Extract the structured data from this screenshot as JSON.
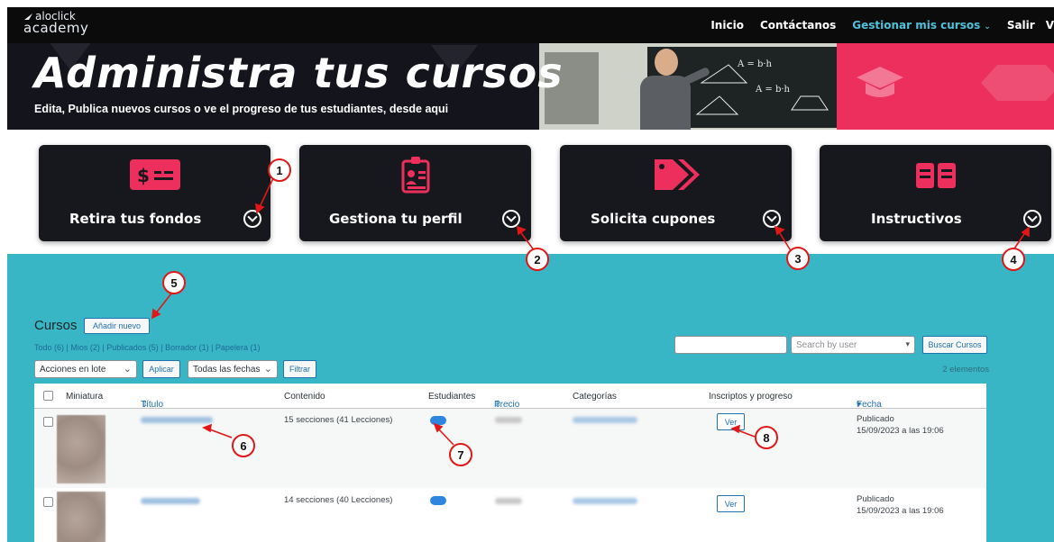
{
  "brand": {
    "line1": "aloclick",
    "line2": "academy"
  },
  "nav": {
    "home": "Inicio",
    "contact": "Contáctanos",
    "manage": "Gestionar mis cursos",
    "logout": "Salir",
    "extra": "V"
  },
  "hero": {
    "title": "Administra tus cursos",
    "subtitle": "Edita, Publica nuevos cursos o ve el progreso de tus estudiantes, desde aqui"
  },
  "cards": [
    {
      "icon": "money-icon",
      "label": "Retira tus fondos"
    },
    {
      "icon": "profile-id-icon",
      "label": "Gestiona tu perfil"
    },
    {
      "icon": "coupon-tag-icon",
      "label": "Solicita cupones"
    },
    {
      "icon": "book-icon",
      "label": "Instructivos"
    }
  ],
  "annotations": [
    "1",
    "2",
    "3",
    "4",
    "5",
    "6",
    "7",
    "8"
  ],
  "courses": {
    "title": "Cursos",
    "add_new": "Añadir nuevo",
    "filter_links": "Todo (6) | Mios (2) | Publicados (5) | Borrador (1) | Papelera (1)",
    "filter_current": "Mios (2)",
    "search_placeholder": "",
    "search_user_placeholder": "Search by user",
    "search_button": "Buscar Cursos",
    "bulk_actions": "Acciones en lote",
    "apply": "Aplicar",
    "all_dates": "Todas las fechas",
    "filter": "Filtrar",
    "count": "2 elementos",
    "columns": {
      "thumbnail": "Miniatura",
      "title": "Título",
      "content": "Contenido",
      "students": "Estudiantes",
      "price": "Precio",
      "categories": "Categorías",
      "enrolled": "Inscriptos y progreso",
      "date": "Fecha"
    },
    "rows": [
      {
        "content": "15 secciones (41 Lecciones)",
        "view": "Ver",
        "status": "Publicado",
        "date": "15/09/2023 a las 19:06"
      },
      {
        "content": "14 secciones (40 Lecciones)",
        "view": "Ver",
        "status": "Publicado",
        "date": "15/09/2023 a las 19:06"
      }
    ]
  },
  "colors": {
    "accent": "#39b6c6",
    "hero_pink": "#ec2f5c",
    "card_icon": "#ec2f5c",
    "annotation": "#e01818"
  }
}
